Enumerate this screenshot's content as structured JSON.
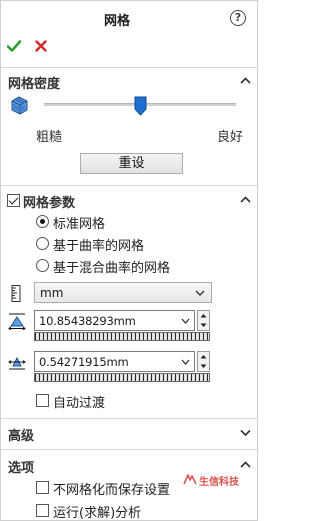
{
  "title": "网格",
  "colors": {
    "accent": "#1f6fd1",
    "ok": "#2f9e2f",
    "cancel": "#d22b2b",
    "watermark": "#d9534f"
  },
  "actions": {
    "ok_icon": "check-icon",
    "cancel_icon": "x-icon",
    "help_icon": "help-icon",
    "help_glyph": "?"
  },
  "density": {
    "header": "网格密度",
    "slider_value": 0.5,
    "coarse_label": "粗糙",
    "fine_label": "良好",
    "reset_label": "重设"
  },
  "params": {
    "header": "网格参数",
    "enabled": true,
    "options": [
      {
        "label": "标准网格",
        "selected": true
      },
      {
        "label": "基于曲率的网格",
        "selected": false
      },
      {
        "label": "基于混合曲率的网格",
        "selected": false
      }
    ],
    "unit": "mm",
    "global_size": "10.85438293mm",
    "tolerance": "0.54271915mm",
    "auto_transition_label": "自动过渡",
    "auto_transition_checked": false
  },
  "advanced": {
    "header": "高级"
  },
  "options": {
    "header": "选项",
    "items": [
      {
        "label": "不网格化而保存设置",
        "checked": false
      },
      {
        "label": "运行(求解)分析",
        "checked": false
      }
    ]
  },
  "watermark": {
    "text": "生信科技"
  }
}
